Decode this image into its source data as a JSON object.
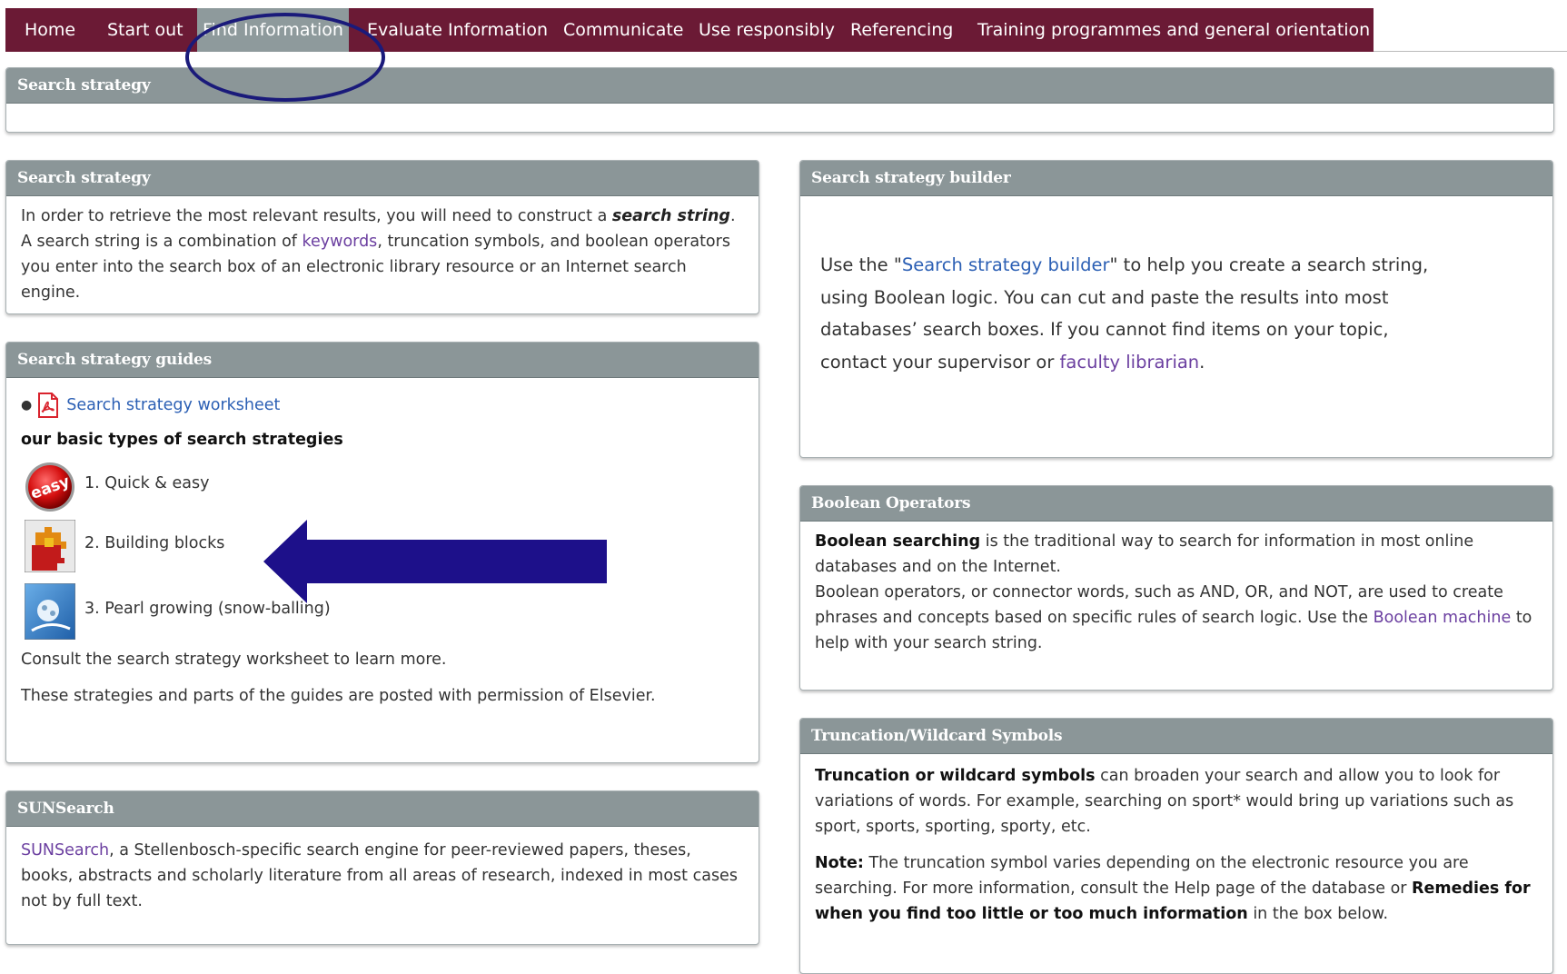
{
  "nav": {
    "items": [
      {
        "label": "Home"
      },
      {
        "label": "Start out"
      },
      {
        "label": "Find Information"
      },
      {
        "label": "Evaluate Information"
      },
      {
        "label": "Communicate"
      },
      {
        "label": "Use responsibly"
      },
      {
        "label": "Referencing"
      },
      {
        "label": "Training programmes and general orientation"
      }
    ],
    "active_index": 2
  },
  "top_panel": {
    "title": "Search strategy"
  },
  "strategy_panel": {
    "title": "Search strategy",
    "text1": "In order to retrieve the most relevant results, you will need to construct a ",
    "bold": "search string",
    "text2": ". A search string is a combination of ",
    "link": "keywords",
    "text3": ", truncation symbols, and boolean operators you enter into the search box of an electronic library resource or an Internet search engine."
  },
  "guides_panel": {
    "title": "Search strategy guides",
    "worksheet_link": "Search strategy worksheet",
    "subheading": "our basic types of search strategies",
    "guides": [
      {
        "label": "1. Quick & easy",
        "icon": "easy-button-icon",
        "badge": "easy"
      },
      {
        "label": "2. Building blocks",
        "icon": "building-blocks-icon"
      },
      {
        "label": "3. Pearl growing (snow-balling)",
        "icon": "snowball-icon"
      }
    ],
    "consult": "Consult the search strategy worksheet to learn more.",
    "permission": "These strategies and parts of the guides are posted with permission of Elsevier."
  },
  "sunsearch_panel": {
    "title": "SUNSearch",
    "link": "SUNSearch",
    "text": ", a Stellenbosch-specific search engine for peer-reviewed papers, theses, books, abstracts and scholarly literature from all areas of research, indexed in most cases not by full text."
  },
  "builder_panel": {
    "title": "Search strategy builder",
    "text1": "Use the \"",
    "link1": "Search strategy builder",
    "text2": "\" to help you create a search string, using Boolean logic. You can cut and paste the results into most databases’ search boxes. If you cannot find items on your topic, contact your supervisor or ",
    "link2": "faculty librarian",
    "text3": "."
  },
  "boolean_panel": {
    "title": "Boolean Operators",
    "bold": "Boolean searching",
    "text1": " is the traditional way to search for information in most online databases and on the Internet.",
    "text2": "Boolean operators, or connector words, such as AND, OR, and NOT, are used to create phrases and concepts based on specific rules of search logic. Use the ",
    "link": "Boolean machine",
    "text3": " to help with your search string."
  },
  "truncation_panel": {
    "title": "Truncation/Wildcard Symbols",
    "bold1": "Truncation or wildcard symbols",
    "text1": " can broaden your search and allow you to look for variations of words. For example, searching on sport* would bring up variations such as sport, sports, sporting, sporty, etc.",
    "note_label": "Note:",
    "text2": " The truncation symbol varies depending on the electronic resource you are searching. For more information, consult the Help page of the database or ",
    "bold2": "Remedies for when you find too little or too much information",
    "text3": " in the box below."
  },
  "colors": {
    "nav_bg": "#6b1a35",
    "nav_active": "#8e9a9c",
    "panel_heading": "#8b9698",
    "link": "#2b5fb4",
    "visited_link": "#6b3fa0",
    "annotation": "#1a1a7a"
  }
}
